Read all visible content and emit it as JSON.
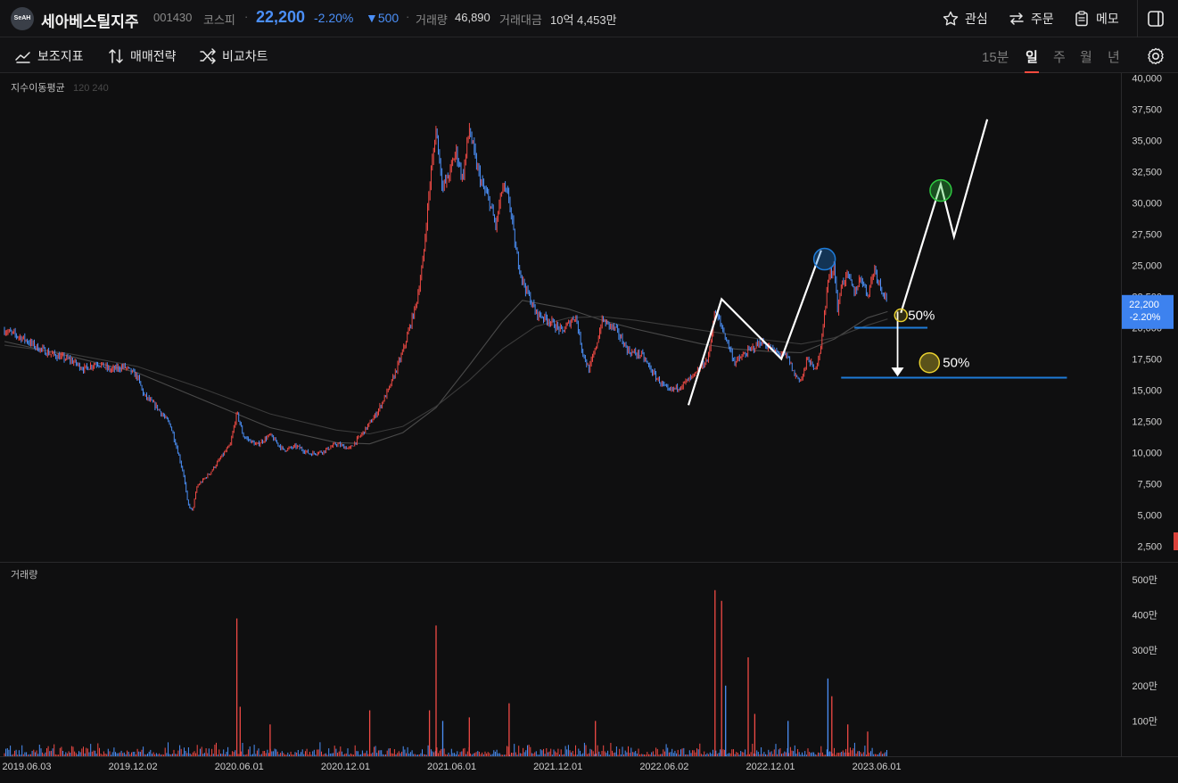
{
  "header": {
    "logo_text": "SeAH",
    "name": "세아베스틸지주",
    "code": "001430",
    "market": "코스피",
    "price": "22,200",
    "change_pct": "-2.20%",
    "change_abs": "▼500",
    "volume_label": "거래량",
    "volume_value": "46,890",
    "amount_label": "거래대금",
    "amount_value": "10억 4,453만",
    "watch_label": "관심",
    "order_label": "주문",
    "memo_label": "메모",
    "sep": "·"
  },
  "toolbar": {
    "indicator_label": "보조지표",
    "strategy_label": "매매전략",
    "compare_label": "비교차트",
    "periods": [
      "15분",
      "일",
      "주",
      "월",
      "년"
    ],
    "active_period": "일"
  },
  "colors": {
    "up": "#f04a45",
    "down": "#4b8ff7",
    "accent_line": "#1e7bd8",
    "background": "#0f0f10"
  },
  "chart_data": {
    "type": "candlestick",
    "price_panel": {
      "legend_title": "지수이동평균",
      "legend_periods": "120  240",
      "y_ticks": [
        "40,000",
        "37,500",
        "35,000",
        "32,500",
        "30,000",
        "27,500",
        "25,000",
        "22,500",
        "20,000",
        "17,500",
        "15,000",
        "12,500",
        "10,000",
        "7,500",
        "5,000",
        "2,500"
      ],
      "ylim": [
        1250,
        40400
      ],
      "current_price_tag": {
        "price": "22,200",
        "change": "-2.20%",
        "value": 22200
      },
      "price_path": [
        [
          0,
          19800
        ],
        [
          3,
          19100
        ],
        [
          5,
          18400
        ],
        [
          7,
          17900
        ],
        [
          10,
          17400
        ],
        [
          12,
          16700
        ],
        [
          14,
          17200
        ],
        [
          16,
          16600
        ],
        [
          18,
          16900
        ],
        [
          20,
          16100
        ],
        [
          21,
          14600
        ],
        [
          23,
          13600
        ],
        [
          25,
          12200
        ],
        [
          26,
          10300
        ],
        [
          27,
          8200
        ],
        [
          27.6,
          5900
        ],
        [
          28.3,
          5300
        ],
        [
          29,
          7300
        ],
        [
          31,
          8400
        ],
        [
          33,
          9900
        ],
        [
          34,
          10600
        ],
        [
          35,
          13200
        ],
        [
          36,
          11300
        ],
        [
          38,
          10600
        ],
        [
          40,
          11400
        ],
        [
          42,
          10200
        ],
        [
          44,
          10500
        ],
        [
          46,
          9900
        ],
        [
          48,
          10100
        ],
        [
          50,
          10700
        ],
        [
          52,
          10300
        ],
        [
          54,
          11600
        ],
        [
          56,
          13100
        ],
        [
          58,
          15200
        ],
        [
          60,
          18100
        ],
        [
          62,
          21900
        ],
        [
          63,
          25200
        ],
        [
          64,
          31200
        ],
        [
          65,
          36000
        ],
        [
          66,
          31200
        ],
        [
          67,
          32300
        ],
        [
          68,
          34200
        ],
        [
          69,
          31900
        ],
        [
          70,
          36000
        ],
        [
          71,
          33200
        ],
        [
          72,
          31300
        ],
        [
          73,
          30200
        ],
        [
          74,
          28100
        ],
        [
          75,
          31300
        ],
        [
          76,
          30300
        ],
        [
          77,
          26200
        ],
        [
          78,
          23800
        ],
        [
          80,
          21200
        ],
        [
          82,
          20600
        ],
        [
          84,
          19700
        ],
        [
          86,
          21000
        ],
        [
          87,
          18200
        ],
        [
          88,
          16600
        ],
        [
          89,
          18300
        ],
        [
          90,
          20600
        ],
        [
          92,
          19900
        ],
        [
          94,
          18100
        ],
        [
          96,
          17800
        ],
        [
          98,
          16100
        ],
        [
          100,
          14900
        ],
        [
          102,
          15400
        ],
        [
          104,
          16200
        ],
        [
          106,
          17600
        ],
        [
          107,
          21400
        ],
        [
          108,
          20100
        ],
        [
          110,
          17200
        ],
        [
          112,
          18100
        ],
        [
          114,
          18900
        ],
        [
          116,
          18100
        ],
        [
          118,
          17600
        ],
        [
          119,
          16200
        ],
        [
          120,
          15800
        ],
        [
          121,
          17600
        ],
        [
          122,
          16500
        ],
        [
          123,
          18600
        ],
        [
          124,
          23800
        ],
        [
          125,
          25000
        ],
        [
          125.5,
          21100
        ],
        [
          126,
          23500
        ],
        [
          127,
          24200
        ],
        [
          128,
          22800
        ],
        [
          129,
          24100
        ],
        [
          130,
          22600
        ],
        [
          131,
          24800
        ],
        [
          132,
          23200
        ],
        [
          133,
          22200
        ]
      ],
      "ema120_path": [
        [
          0,
          18900
        ],
        [
          10,
          17700
        ],
        [
          20,
          16400
        ],
        [
          30,
          14200
        ],
        [
          40,
          12000
        ],
        [
          50,
          10800
        ],
        [
          55,
          10700
        ],
        [
          60,
          11600
        ],
        [
          65,
          13600
        ],
        [
          70,
          17000
        ],
        [
          75,
          20500
        ],
        [
          78,
          22200
        ],
        [
          85,
          21500
        ],
        [
          90,
          20600
        ],
        [
          95,
          19900
        ],
        [
          100,
          19300
        ],
        [
          105,
          18700
        ],
        [
          110,
          18300
        ],
        [
          115,
          18100
        ],
        [
          120,
          18000
        ],
        [
          125,
          19100
        ],
        [
          130,
          20800
        ],
        [
          133,
          21300
        ]
      ],
      "ema240_path": [
        [
          0,
          18600
        ],
        [
          10,
          17900
        ],
        [
          20,
          16900
        ],
        [
          30,
          15100
        ],
        [
          40,
          13100
        ],
        [
          50,
          11800
        ],
        [
          55,
          11500
        ],
        [
          60,
          12100
        ],
        [
          65,
          13700
        ],
        [
          70,
          15800
        ],
        [
          75,
          18300
        ],
        [
          80,
          20100
        ],
        [
          85,
          20800
        ],
        [
          90,
          20900
        ],
        [
          95,
          20600
        ],
        [
          100,
          20200
        ],
        [
          105,
          19800
        ],
        [
          110,
          19400
        ],
        [
          115,
          19000
        ],
        [
          120,
          18700
        ],
        [
          125,
          19200
        ],
        [
          130,
          20200
        ],
        [
          133,
          20700
        ]
      ],
      "drawn_zigzag": [
        [
          103,
          13800
        ],
        [
          108,
          22300
        ],
        [
          117,
          17500
        ],
        [
          123,
          26200
        ]
      ],
      "drawn_projection": [
        [
          135,
          21200
        ],
        [
          141,
          31500
        ],
        [
          143,
          27300
        ],
        [
          148,
          36700
        ]
      ],
      "drawn_arrow": {
        "x": 134.5,
        "from": 21300,
        "to": 16100
      },
      "drawn_levels": [
        {
          "x_start": 128,
          "x_end": 139,
          "value": 20000,
          "label": "50%",
          "label_value": 21000
        },
        {
          "x_start": 126,
          "x_end": 160,
          "value": 16000,
          "label": "50%",
          "label_value": 17200
        }
      ],
      "drawn_circles": [
        {
          "x": 123.5,
          "value": 25500,
          "color": "#1e7bd8"
        },
        {
          "x": 141,
          "value": 31000,
          "color": "#2ec840"
        },
        {
          "x": 135,
          "value": 21000,
          "color": "#e8d02f"
        },
        {
          "x": 139.3,
          "value": 17200,
          "color": "#e8d02f"
        }
      ]
    },
    "volume_panel": {
      "legend_title": "거래량",
      "y_ticks": [
        "500만",
        "400만",
        "300만",
        "200만",
        "100만"
      ],
      "ylim": [
        0,
        5200000
      ],
      "spikes": [
        {
          "x": 35,
          "value": 3900000,
          "color": "up"
        },
        {
          "x": 35.5,
          "value": 1400000,
          "color": "up"
        },
        {
          "x": 40,
          "value": 900000,
          "color": "up"
        },
        {
          "x": 55,
          "value": 1300000,
          "color": "up"
        },
        {
          "x": 64,
          "value": 1300000,
          "color": "up"
        },
        {
          "x": 65,
          "value": 3700000,
          "color": "up"
        },
        {
          "x": 66,
          "value": 1000000,
          "color": "down"
        },
        {
          "x": 70,
          "value": 1100000,
          "color": "up"
        },
        {
          "x": 76,
          "value": 1500000,
          "color": "up"
        },
        {
          "x": 89,
          "value": 1000000,
          "color": "up"
        },
        {
          "x": 107,
          "value": 4700000,
          "color": "up"
        },
        {
          "x": 108,
          "value": 4400000,
          "color": "up"
        },
        {
          "x": 108.6,
          "value": 2000000,
          "color": "down"
        },
        {
          "x": 112,
          "value": 2800000,
          "color": "up"
        },
        {
          "x": 113,
          "value": 1200000,
          "color": "up"
        },
        {
          "x": 118,
          "value": 1000000,
          "color": "down"
        },
        {
          "x": 124,
          "value": 2200000,
          "color": "down"
        },
        {
          "x": 124.6,
          "value": 1700000,
          "color": "up"
        },
        {
          "x": 127,
          "value": 900000,
          "color": "up"
        },
        {
          "x": 130,
          "value": 700000,
          "color": "up"
        }
      ]
    },
    "x_axis": {
      "labels": [
        "2019.06.03",
        "2019.12.02",
        "2020.06.01",
        "2020.12.01",
        "2021.06.01",
        "2021.12.01",
        "2022.06.02",
        "2022.12.01",
        "2023.06.01"
      ],
      "label_positions": [
        0,
        16,
        32,
        48,
        64,
        80,
        96,
        112,
        128
      ],
      "xlim": [
        0,
        168
      ]
    }
  }
}
